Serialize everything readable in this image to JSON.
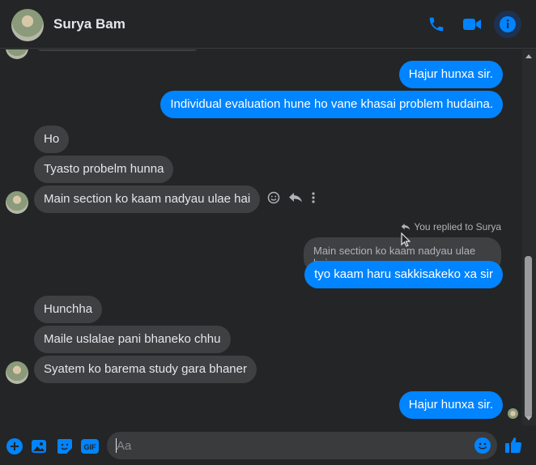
{
  "header": {
    "contact_name": "Surya Bam",
    "icons": [
      "phone-icon",
      "video-camera-icon",
      "info-icon"
    ],
    "accent_color": "#0084ff"
  },
  "messages": [
    {
      "direction": "out",
      "text": "Hajur hunxa sir."
    },
    {
      "direction": "out",
      "text": "Individual evaluation hune ho vane khasai problem hudaina."
    },
    {
      "direction": "in",
      "text": "Ho"
    },
    {
      "direction": "in",
      "text": "Tyasto probelm hunna"
    },
    {
      "direction": "in",
      "text": "Main section ko kaam nadyau ulae hai"
    },
    {
      "direction": "out",
      "text": "tyo kaam haru sakkisakeko xa sir"
    },
    {
      "direction": "in",
      "text": "Hunchha"
    },
    {
      "direction": "in",
      "text": "Maile  uslalae pani bhaneko chhu"
    },
    {
      "direction": "in",
      "text": "Syatem ko barema study gara bhaner"
    },
    {
      "direction": "out",
      "text": "Hajur hunxa sir."
    }
  ],
  "reply": {
    "note": "You replied to Surya",
    "quoted_text": "Main section ko kaam nadyau ulae hai"
  },
  "composer": {
    "placeholder": "Aa",
    "icons": [
      "plus-icon",
      "image-icon",
      "sticker-icon",
      "gif-icon",
      "emoji-icon",
      "thumbs-up-icon"
    ]
  }
}
